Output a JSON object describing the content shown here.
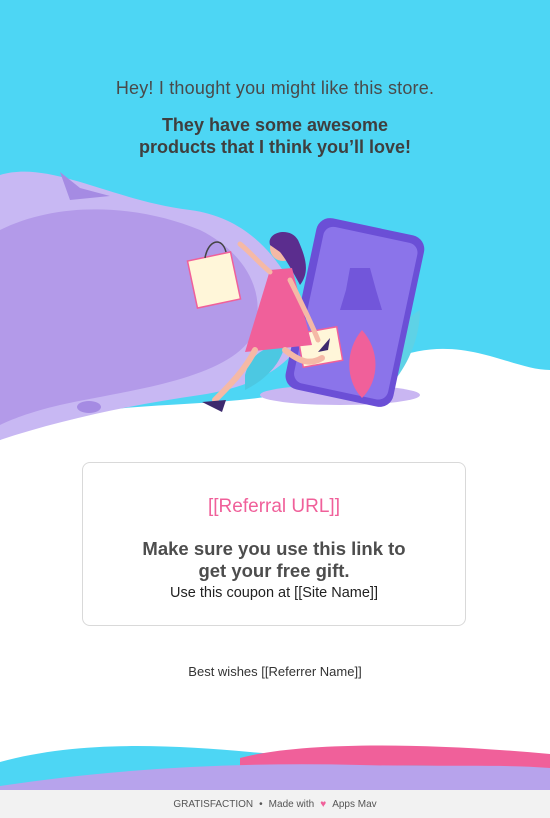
{
  "header": {
    "greeting": "Hey! I thought you might like this store.",
    "tagline_line1": "They have some awesome",
    "tagline_line2": "products that I think you’ll love!"
  },
  "card": {
    "referral_url": "[[Referral URL]]",
    "message_line1": "Make sure you use this link to",
    "message_line2": "get your free gift.",
    "coupon_text": "Use this coupon at [[Site Name]]"
  },
  "closing": "Best wishes [[Referrer Name]]",
  "footer": {
    "brand": "GRATISFACTION",
    "separator": "•",
    "made_with": "Made with",
    "heart_icon": "heart-icon",
    "maker": "Apps Mav"
  },
  "colors": {
    "sky": "#4dd6f4",
    "lavender": "#b7a3ec",
    "pink_accent": "#f0609a",
    "phone_purple": "#7b5ce0"
  }
}
